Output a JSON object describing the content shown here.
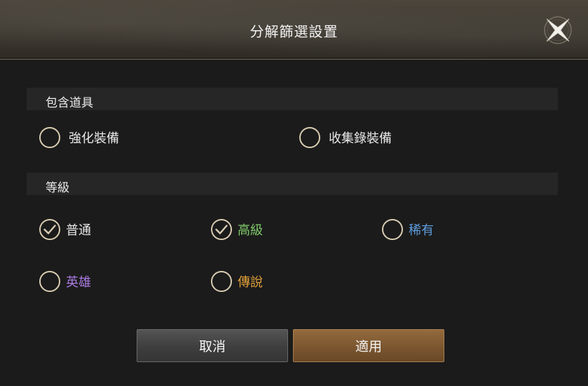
{
  "dialog": {
    "title": "分解篩選設置"
  },
  "sections": {
    "include_items": {
      "label": "包含道具",
      "options": {
        "enhanced": {
          "label": "強化裝備",
          "checked": false
        },
        "collection": {
          "label": "收集錄裝備",
          "checked": false
        }
      }
    },
    "grade": {
      "label": "等級",
      "options": {
        "normal": {
          "label": "普通",
          "checked": true,
          "color": "#e8e8e8"
        },
        "advanced": {
          "label": "高級",
          "checked": true,
          "color": "#7fc96a"
        },
        "rare": {
          "label": "稀有",
          "checked": false,
          "color": "#5e9cde"
        },
        "hero": {
          "label": "英雄",
          "checked": false,
          "color": "#a97ae0"
        },
        "legend": {
          "label": "傳說",
          "checked": false,
          "color": "#e0a03a"
        }
      }
    }
  },
  "buttons": {
    "cancel_label": "取消",
    "apply_label": "適用"
  },
  "icons": {
    "close": "close-icon",
    "check": "check-icon"
  },
  "colors": {
    "radio_border": "#d8ccb1",
    "apply_button": "#7b5630",
    "cancel_button": "#3e3e3e"
  }
}
